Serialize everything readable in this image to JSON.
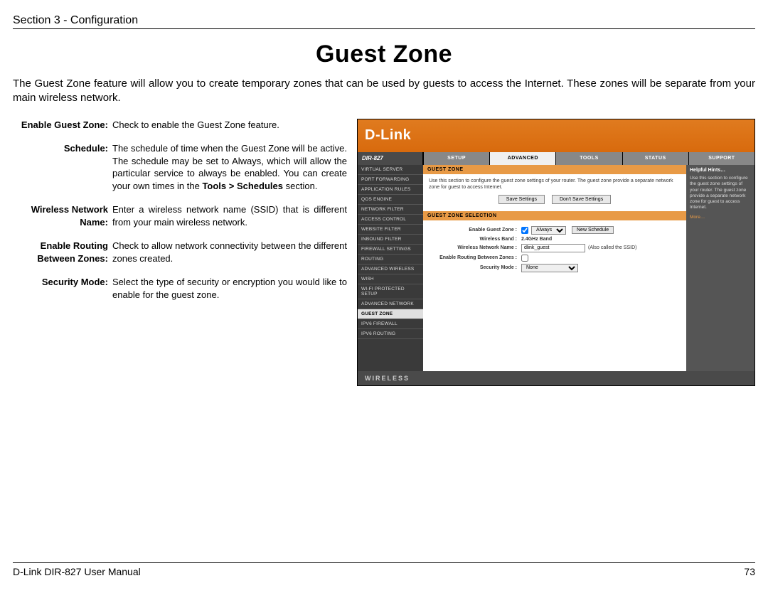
{
  "header": {
    "section_label": "Section 3 - Configuration"
  },
  "title": "Guest Zone",
  "intro": "The Guest Zone feature will allow you to create temporary zones that can be used by guests to access the Internet. These zones will be separate from your main wireless network.",
  "definitions": [
    {
      "term": "Enable Guest Zone:",
      "desc": "Check to enable the Guest Zone feature."
    },
    {
      "term": "Schedule:",
      "desc_pre": "The schedule of time when the Guest Zone will be active. The schedule may be set to Always, which will allow the particular service to always be enabled. You can create your own times in the ",
      "desc_bold": "Tools > Schedules",
      "desc_post": " section."
    },
    {
      "term": "Wireless Network Name:",
      "desc": "Enter a wireless network name (SSID) that is different from your main wireless network."
    },
    {
      "term": "Enable Routing Between Zones:",
      "desc": "Check to allow network connectivity between the different zones created."
    },
    {
      "term": "Security Mode:",
      "desc": "Select the type of security or encryption you would like to enable for the guest zone."
    }
  ],
  "router": {
    "brand": "D-Link",
    "model": "DIR-827",
    "tabs": [
      "SETUP",
      "ADVANCED",
      "TOOLS",
      "STATUS",
      "SUPPORT"
    ],
    "active_tab": "ADVANCED",
    "sidebar": [
      "VIRTUAL SERVER",
      "PORT FORWARDING",
      "APPLICATION RULES",
      "QOS ENGINE",
      "NETWORK FILTER",
      "ACCESS CONTROL",
      "WEBSITE FILTER",
      "INBOUND FILTER",
      "FIREWALL SETTINGS",
      "ROUTING",
      "ADVANCED WIRELESS",
      "WISH",
      "WI-FI PROTECTED SETUP",
      "ADVANCED NETWORK",
      "GUEST ZONE",
      "IPV6 FIREWALL",
      "IPV6 ROUTING"
    ],
    "sidebar_active": "GUEST ZONE",
    "panel1": {
      "head": "GUEST ZONE",
      "desc": "Use this section to configure the guest zone settings of your router. The guest zone provide a separate network zone for guest to access Internet.",
      "save": "Save Settings",
      "dont": "Don't Save Settings"
    },
    "panel2": {
      "head": "GUEST ZONE SELECTION",
      "rows": {
        "enable_label": "Enable Guest Zone :",
        "enable_checked": true,
        "schedule_select": "Always",
        "new_schedule_btn": "New Schedule",
        "band_label": "Wireless Band :",
        "band_value": "2.4GHz Band",
        "name_label": "Wireless Network Name :",
        "name_value": "dlink_guest",
        "name_hint": "(Also called the SSID)",
        "routing_label": "Enable Routing Between Zones :",
        "routing_checked": false,
        "sec_label": "Security Mode :",
        "sec_value": "None"
      }
    },
    "hints": {
      "title": "Helpful Hints…",
      "body": "Use this section to configure the guest zone settings of your router. The guest zone provide a separate network zone for guest to access Internet.",
      "more": "More…"
    },
    "footer_word": "WIRELESS"
  },
  "footer": {
    "manual": "D-Link DIR-827 User Manual",
    "page": "73"
  }
}
